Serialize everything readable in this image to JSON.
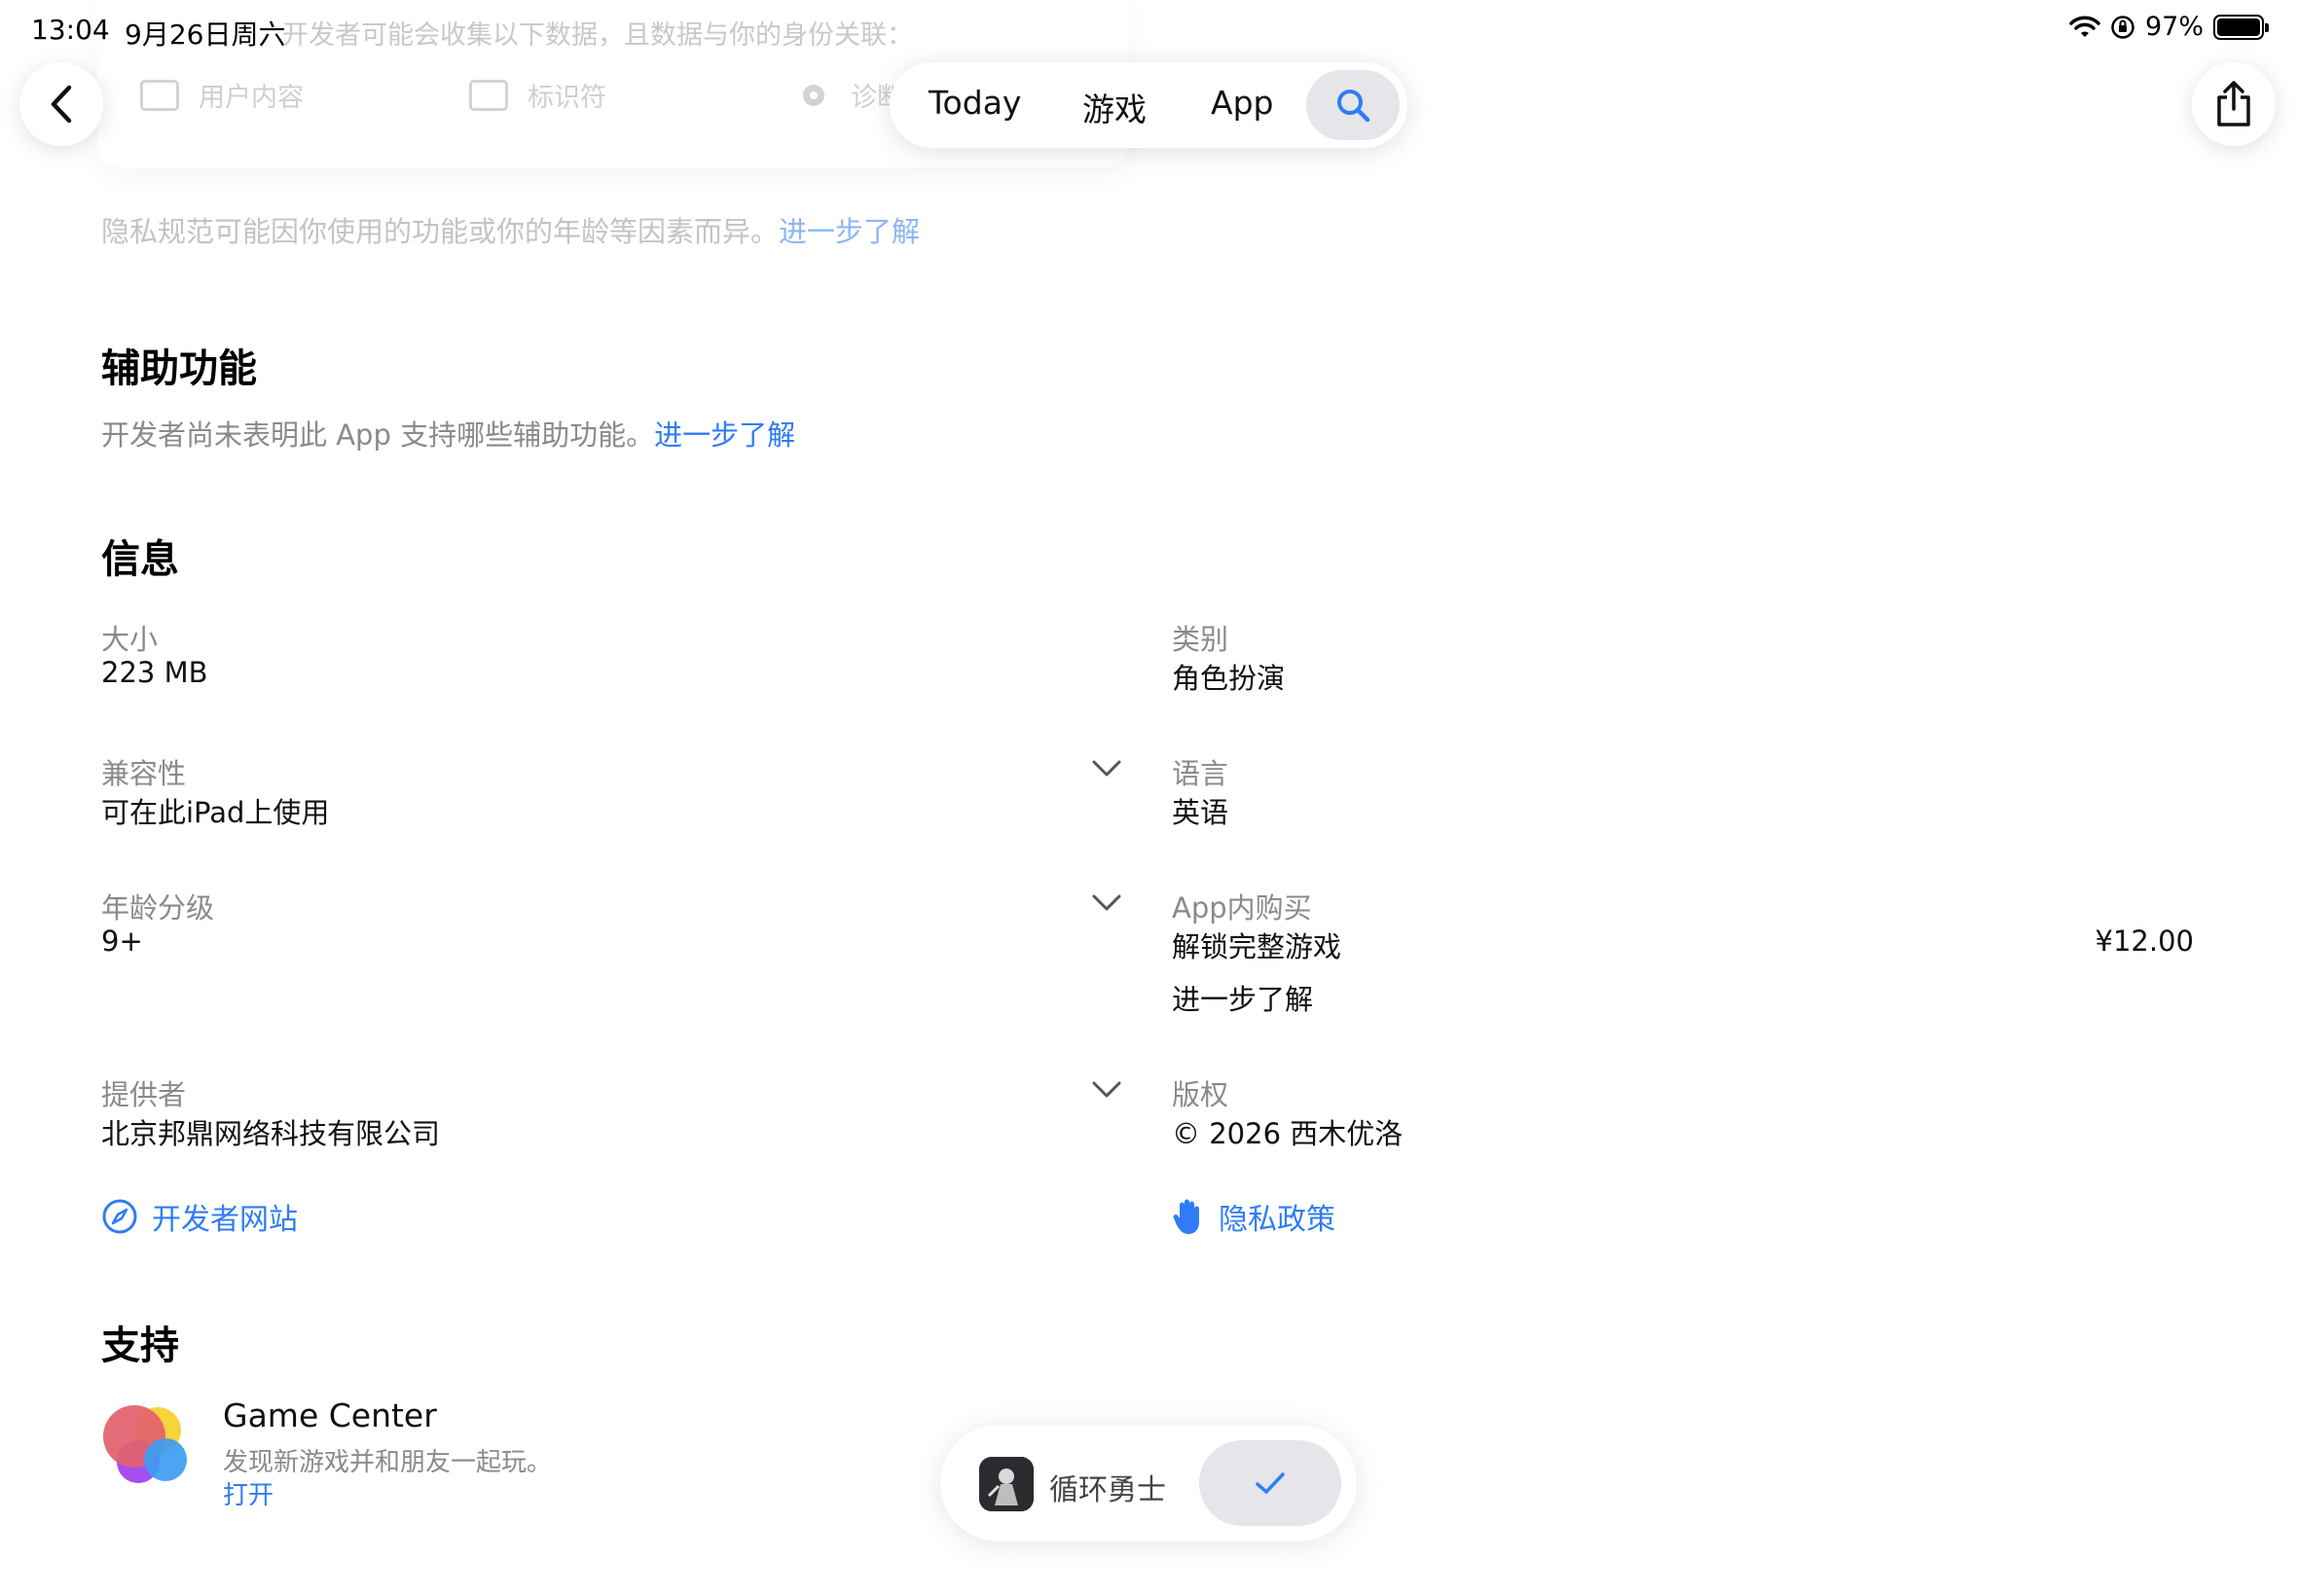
{
  "status_bar": {
    "time": "13:04",
    "date": "9月26日周六",
    "battery": "97%"
  },
  "faded_header": {
    "collected_text": "开发者可能会收集以下数据，且数据与你的身份关联：",
    "items": [
      {
        "label": "用户内容",
        "icon": "photo-icon"
      },
      {
        "label": "标识符",
        "icon": "id-card-icon"
      },
      {
        "label": "诊断",
        "icon": "gear-icon"
      }
    ]
  },
  "tabs": [
    {
      "label": "Today"
    },
    {
      "label": "游戏"
    },
    {
      "label": "App"
    }
  ],
  "privacy_note": {
    "text": "隐私规范可能因你使用的功能或你的年龄等因素而异。",
    "link": "进一步了解"
  },
  "accessibility": {
    "title": "辅助功能",
    "text": "开发者尚未表明此 App 支持哪些辅助功能。",
    "link": "进一步了解"
  },
  "info": {
    "title": "信息",
    "size_label": "大小",
    "size_value": "223 MB",
    "category_label": "类别",
    "category_value": "角色扮演",
    "compat_label": "兼容性",
    "compat_value": "可在此iPad上使用",
    "language_label": "语言",
    "language_value": "英语",
    "age_label": "年龄分级",
    "age_value": "9+",
    "iap_label": "App内购买",
    "iap_item": "解锁完整游戏",
    "iap_price": "¥12.00",
    "iap_link": "进一步了解",
    "provider_label": "提供者",
    "provider_value": "北京邦鼎网络科技有限公司",
    "copyright_label": "版权",
    "copyright_value": "© 2026 西木优洛",
    "developer_site": "开发者网站",
    "privacy_policy": "隐私政策"
  },
  "support": {
    "title": "支持",
    "gc_title": "Game Center",
    "gc_sub": "发现新游戏并和朋友一起玩。",
    "gc_open": "打开"
  },
  "install_pill": {
    "app_name": "循环勇士",
    "state_icon": "checkmark-icon"
  },
  "colors": {
    "accent": "#2f7cf6",
    "secondary_text": "#8a8a8e"
  }
}
